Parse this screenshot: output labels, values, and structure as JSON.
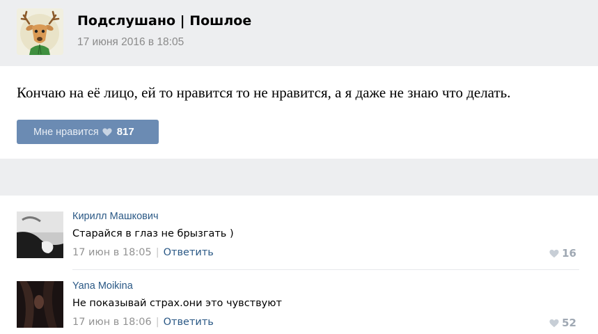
{
  "post": {
    "group_name": "Подслушано | Пошлое",
    "date": "17 июня 2016 в 18:05",
    "text": "Кончаю на её лицо, ей то нравится то не нравится, а я даже не знаю что делать.",
    "like_label": "Мне нравится",
    "like_count": "817"
  },
  "comments": [
    {
      "author": "Кирилл Машкович",
      "text": "Старайся в глаз не брызгать )",
      "date": "17 июн в 18:05",
      "separator": "|",
      "reply_label": "Ответить",
      "likes": "16"
    },
    {
      "author": "Yana Moikina",
      "text": "Не показывай страх.они это чувствуют",
      "date": "17 июн в 18:06",
      "separator": "|",
      "reply_label": "Ответить",
      "likes": "52"
    }
  ],
  "colors": {
    "accent": "#6b8bb3",
    "link": "#2a5885",
    "band": "#edeef0"
  },
  "icons": {
    "group_avatar": "deer-avatar-icon",
    "like": "heart-icon"
  }
}
